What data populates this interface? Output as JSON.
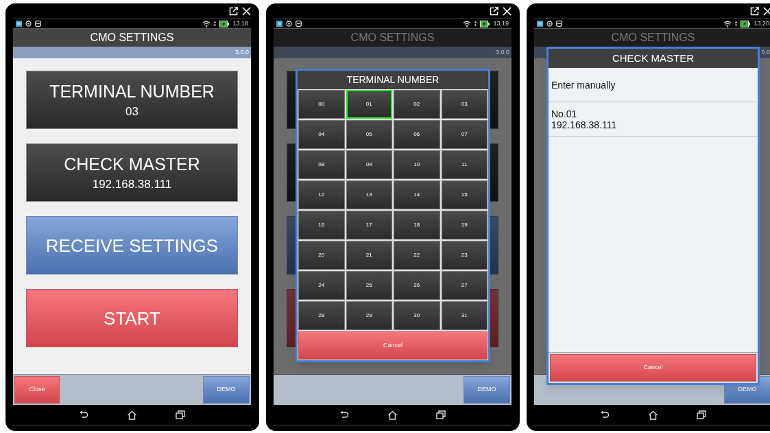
{
  "screens": [
    {
      "status_time": "13.18",
      "title": "CMO SETTINGS",
      "version": "3.0.0",
      "dimmed": false,
      "main_buttons": [
        {
          "kind": "dark",
          "title": "TERMINAL NUMBER",
          "value": "03"
        },
        {
          "kind": "dark",
          "title": "CHECK MASTER",
          "value": "192.168.38.111"
        },
        {
          "kind": "blue",
          "title": "RECEIVE SETTINGS"
        },
        {
          "kind": "red",
          "title": "START"
        }
      ],
      "bottom_bar": {
        "close": "Close",
        "demo": "DEMO"
      }
    },
    {
      "status_time": "13.19",
      "title": "CMO SETTINGS",
      "version": "3.0.0",
      "dimmed": true,
      "main_buttons": [
        {
          "kind": "dark"
        },
        {
          "kind": "dark"
        },
        {
          "kind": "blue"
        },
        {
          "kind": "red"
        }
      ],
      "bottom_bar": {
        "demo": "DEMO"
      },
      "dialog": {
        "kind": "grid",
        "title": "TERMINAL NUMBER",
        "numbers": [
          {
            "label": "00",
            "selected": false
          },
          {
            "label": "01",
            "selected": true
          },
          {
            "label": "02",
            "selected": false
          },
          {
            "label": "03",
            "selected": false
          },
          {
            "label": "04",
            "selected": false
          },
          {
            "label": "05",
            "selected": false
          },
          {
            "label": "06",
            "selected": false
          },
          {
            "label": "07",
            "selected": false
          },
          {
            "label": "08",
            "selected": false
          },
          {
            "label": "09",
            "selected": false
          },
          {
            "label": "10",
            "selected": false
          },
          {
            "label": "11",
            "selected": false
          },
          {
            "label": "12",
            "selected": false
          },
          {
            "label": "13",
            "selected": false
          },
          {
            "label": "14",
            "selected": false
          },
          {
            "label": "15",
            "selected": false
          },
          {
            "label": "16",
            "selected": false
          },
          {
            "label": "17",
            "selected": false
          },
          {
            "label": "18",
            "selected": false
          },
          {
            "label": "19",
            "selected": false
          },
          {
            "label": "20",
            "selected": false
          },
          {
            "label": "21",
            "selected": false
          },
          {
            "label": "22",
            "selected": false
          },
          {
            "label": "23",
            "selected": false
          },
          {
            "label": "24",
            "selected": false
          },
          {
            "label": "25",
            "selected": false
          },
          {
            "label": "26",
            "selected": false
          },
          {
            "label": "27",
            "selected": false
          },
          {
            "label": "28",
            "selected": false
          },
          {
            "label": "29",
            "selected": false
          },
          {
            "label": "30",
            "selected": false
          },
          {
            "label": "31",
            "selected": false
          }
        ],
        "cancel": "Cancel"
      }
    },
    {
      "status_time": "13.20",
      "title": "CMO SETTINGS",
      "version": "0.0",
      "dimmed": true,
      "bottom_bar": {
        "demo": "DEMO"
      },
      "dialog": {
        "kind": "list",
        "title": "CHECK MASTER",
        "items": [
          {
            "lines": [
              "Enter manually"
            ]
          },
          {
            "lines": [
              "No.01",
              "192.168.38.111"
            ]
          }
        ],
        "cancel": "Cancel"
      }
    }
  ]
}
